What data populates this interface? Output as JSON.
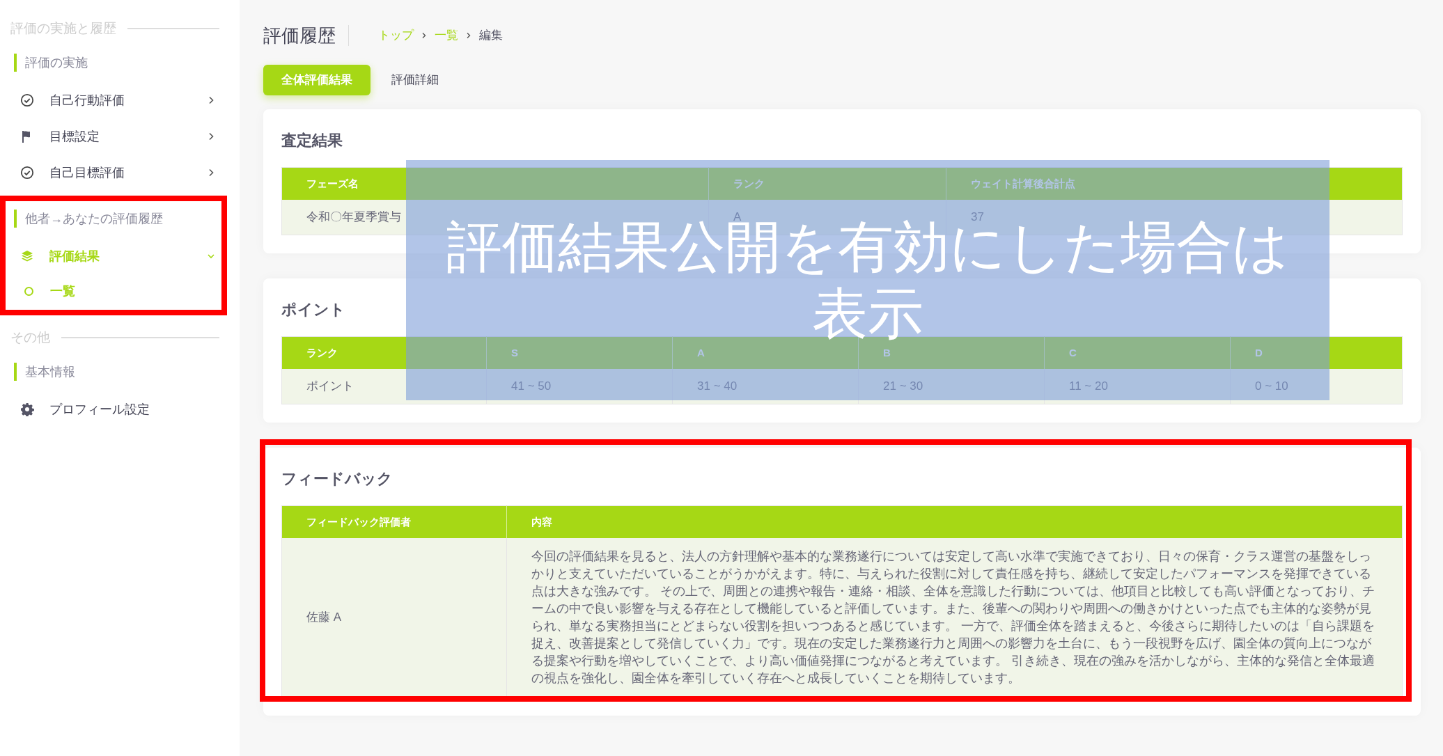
{
  "sidebar": {
    "sections": [
      {
        "title": "評価の実施と履歴",
        "groups": [
          {
            "label": "評価の実施",
            "items": [
              {
                "label": "自己行動評価",
                "kind": "check",
                "expanded": false,
                "selected": false
              },
              {
                "label": "目標設定",
                "kind": "flag",
                "expanded": false,
                "selected": false
              },
              {
                "label": "自己目標評価",
                "kind": "check",
                "expanded": false,
                "selected": false
              }
            ]
          },
          {
            "label": "他者→あなたの評価履歴",
            "items": [
              {
                "label": "評価結果",
                "kind": "layers",
                "expanded": true,
                "selected": true,
                "children": [
                  {
                    "label": "一覧",
                    "selected": true
                  }
                ]
              }
            ]
          }
        ]
      },
      {
        "title": "その他",
        "groups": [
          {
            "label": "基本情報",
            "items": [
              {
                "label": "プロフィール設定",
                "kind": "gear"
              }
            ]
          }
        ]
      }
    ]
  },
  "page_title": "評価履歴",
  "breadcrumb": [
    {
      "label": "トップ",
      "kind": "link"
    },
    {
      "label": "一覧",
      "kind": "link"
    },
    {
      "label": "編集",
      "kind": "current"
    }
  ],
  "tabs": [
    {
      "label": "全体評価結果",
      "selected": true
    },
    {
      "label": "評価詳細",
      "selected": false
    }
  ],
  "cards": [
    {
      "title": "査定結果",
      "table": {
        "columns": [
          "フェーズ名",
          "ランク",
          "ウェイト計算後合計点"
        ],
        "rows": [
          [
            "令和〇年夏季賞与",
            "A",
            "37"
          ]
        ]
      }
    },
    {
      "title": "ポイント",
      "table": {
        "columns": [
          "ランク",
          "S",
          "A",
          "B",
          "C",
          "D"
        ],
        "rows": [
          [
            "ポイント",
            "41 ~ 50",
            "31 ~ 40",
            "21 ~ 30",
            "11 ~ 20",
            "0 ~ 10"
          ]
        ]
      }
    },
    {
      "title": "フィードバック",
      "table": {
        "columns": [
          "フィードバック評価者",
          "内容"
        ],
        "rows": [
          [
            "佐藤 A",
            "今回の評価結果を見ると、法人の方針理解や基本的な業務遂行については安定して高い水準で実施できており、日々の保育・クラス運営の基盤をしっかりと支えていただいていることがうかがえます。特に、与えられた役割に対して責任感を持ち、継続して安定したパフォーマンスを発揮できている点は大きな強みです。 その上で、周囲との連携や報告・連絡・相談、全体を意識した行動については、他項目と比較しても高い評価となっており、チームの中で良い影響を与える存在として機能していると評価しています。また、後輩への関わりや周囲への働きかけといった点でも主体的な姿勢が見られ、単なる実務担当にとどまらない役割を担いつつあると感じています。 一方で、評価全体を踏まえると、今後さらに期待したいのは「自ら課題を捉え、改善提案として発信していく力」です。現在の安定した業務遂行力と周囲への影響力を土台に、もう一段視野を広げ、園全体の質向上につながる提案や行動を増やしていくことで、より高い価値発揮につながると考えています。 引き続き、現在の強みを活かしながら、主体的な発信と全体最適の視点を強化し、園全体を牽引していく存在へと成長していくことを期待しています。"
          ]
        ]
      }
    }
  ],
  "annotation_note": "評価結果公開を有効にした場合は表示"
}
